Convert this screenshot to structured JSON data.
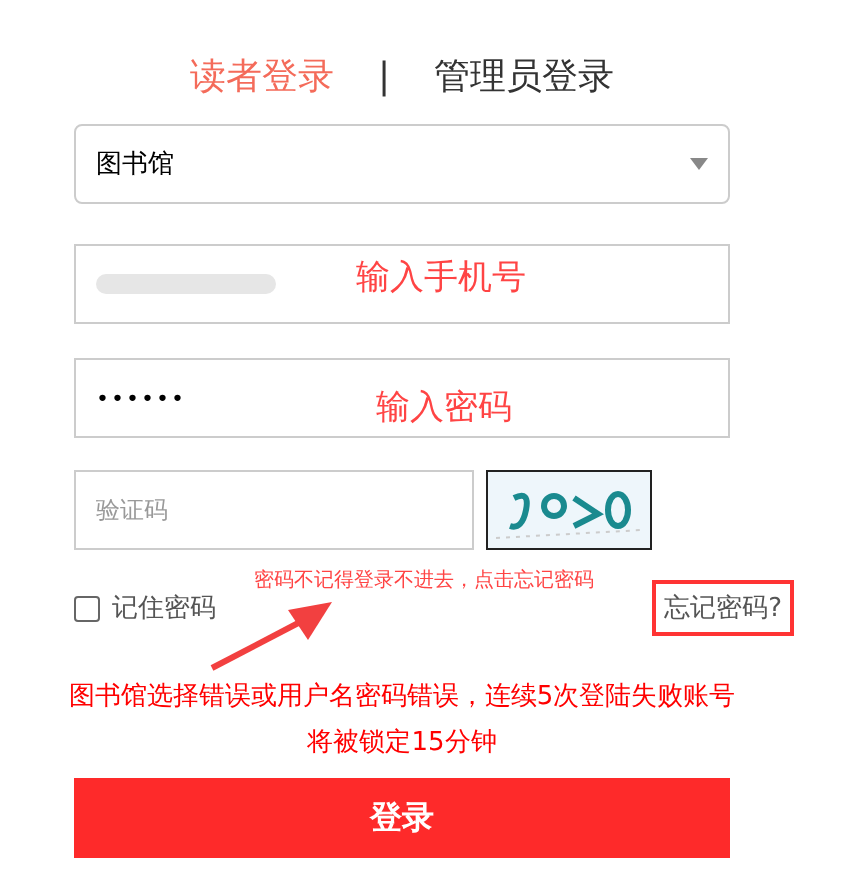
{
  "tabs": [
    {
      "label": "读者登录",
      "selected": true
    },
    {
      "label": "管理员登录",
      "selected": false
    }
  ],
  "tab_separator": "|",
  "library_select": {
    "value": "图书馆"
  },
  "phone_field": {
    "redacted": true,
    "annotation": "输入手机号"
  },
  "password_field": {
    "value": "••••••",
    "annotation": "输入密码"
  },
  "captcha_field": {
    "placeholder": "验证码"
  },
  "captcha_annotation": "密码不记得登录不进去，点击忘记密码",
  "remember": {
    "label": "记住密码",
    "checked": false
  },
  "forgot_link": {
    "label": "忘记密码?",
    "highlighted": true
  },
  "notice_lines": [
    "图书馆选择错误或用户名密码错误，连续5次登陆失败账号",
    "将被锁定15分钟"
  ],
  "login_button": "登录"
}
